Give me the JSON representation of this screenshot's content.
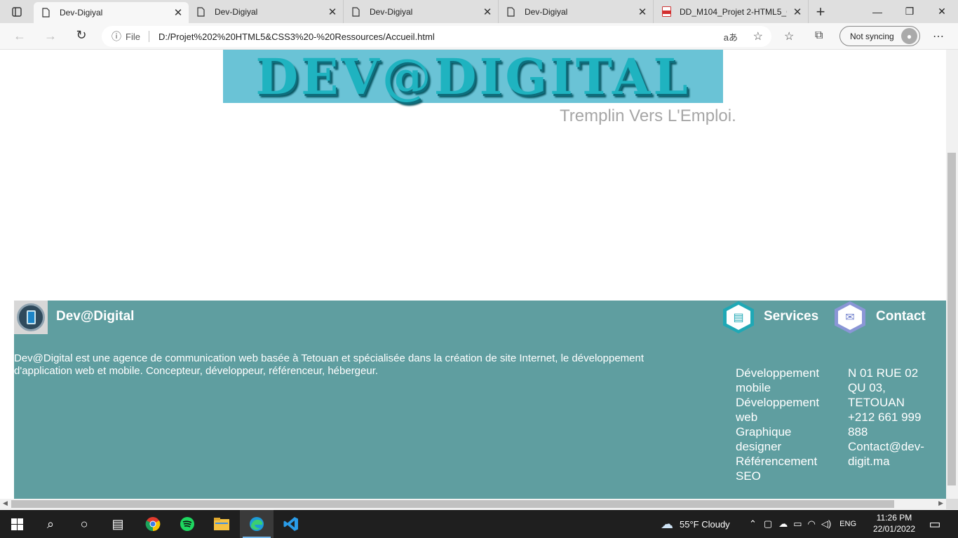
{
  "browser": {
    "tabs": [
      {
        "title": "Dev-Digiyal",
        "active": true,
        "icon": "page-icon"
      },
      {
        "title": "Dev-Digiyal",
        "active": false,
        "icon": "page-icon"
      },
      {
        "title": "Dev-Digiyal",
        "active": false,
        "icon": "page-icon"
      },
      {
        "title": "Dev-Digiyal",
        "active": false,
        "icon": "page-icon"
      },
      {
        "title": "DD_M104_Projet 2-HTML5_C",
        "active": false,
        "icon": "pdf-icon"
      }
    ],
    "file_label": "File",
    "url": "D:/Projet%202%20HTML5&CSS3%20-%20Ressources/Accueil.html",
    "read_aloud_glyph": "aあ",
    "sync_label": "Not syncing"
  },
  "page": {
    "logo_text": "DEV@DIGITAL",
    "tagline": "Tremplin Vers L'Emploi.",
    "footer": {
      "brand": "Dev@Digital",
      "description": "Dev@Digital est une agence de communication web basée à Tetouan et spécialisée dans la création de site Internet, le développement d'application web et mobile. Concepteur, développeur, référenceur, hébergeur.",
      "services_title": "Services",
      "services_lines": [
        "Développement",
        "mobile",
        "Développement",
        "web",
        "Graphique",
        "designer",
        "Référencement",
        "SEO"
      ],
      "contact_title": "Contact",
      "contact_lines": [
        "N 01 RUE 02",
        "QU 03,",
        "TETOUAN",
        "+212 661 999",
        "888",
        "Contact@dev-",
        "digit.ma"
      ]
    }
  },
  "taskbar": {
    "weather": "55°F  Cloudy",
    "lang": "ENG",
    "time": "11:26 PM",
    "date": "22/01/2022"
  },
  "colors": {
    "footer_bg": "#5f9ea0",
    "logo_bg": "#6ac3d6",
    "tagline": "#a6a6a6"
  }
}
